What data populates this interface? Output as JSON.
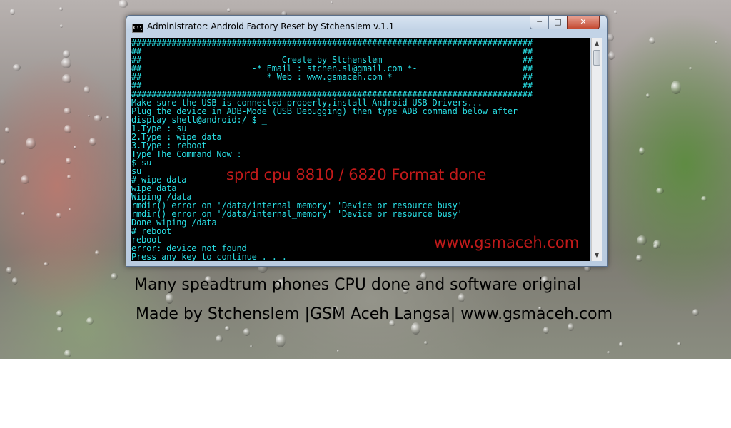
{
  "window": {
    "title": "Administrator:  Android Factory Reset by Stchenslem v.1.1",
    "icon_text": "C:\\",
    "minimize": "─",
    "maximize": "□",
    "close": "✕"
  },
  "console": {
    "lines": [
      "################################################################################",
      "##                                                                            ##",
      "##                            Create by Stchenslem                            ##",
      "##                      -* Email : stchen.sl@gmail.com *-                     ##",
      "##                         * Web : www.gsmaceh.com *                          ##",
      "##                                                                            ##",
      "################################################################################",
      "Make sure the USB is connected properly,install Android USB Drivers...",
      "Plug the device in ADB-Mode (USB Debugging) then type ADB command below after",
      "display shell@android:/ $ _",
      "1.Type : su",
      "2.Type : wipe data",
      "3.Type : reboot",
      "Type The Command Now :",
      "$ su",
      "su",
      "# wipe data",
      "wipe data",
      "Wiping /data",
      "rmdir() error on '/data/internal_memory' 'Device or resource busy'",
      "rmdir() error on '/data/internal_memory' 'Device or resource busy'",
      "Done wiping /data",
      "# reboot",
      "reboot",
      "error: device not found",
      "Press any key to continue . . . "
    ],
    "cursor": "_",
    "text_color": "#29e0e6",
    "overlay_format_text": "sprd cpu 8810 / 6820 Format done",
    "overlay_site_text": "www.gsmaceh.com",
    "overlay_color": "#c11a1a"
  },
  "scrollbar": {
    "up_arrow": "▲",
    "down_arrow": "▼"
  },
  "captions": {
    "line1": "Many speadtrum phones CPU done and software original",
    "line2": "Made by Stchenslem |GSM Aceh Langsa| www.gsmaceh.com"
  }
}
